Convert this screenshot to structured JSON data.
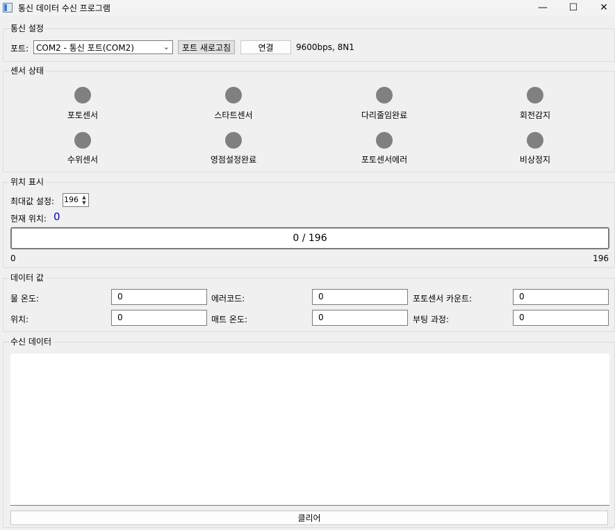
{
  "window": {
    "title": "통신 데이터 수신 프로그램",
    "minimize_glyph": "—",
    "maximize_glyph": "☐",
    "close_glyph": "✕",
    "icon": "app-window-icon"
  },
  "comm": {
    "title": "통신 설정",
    "port_label": "포트:",
    "port_value": "COM2 - 통신 포트(COM2)",
    "refresh_label": "포트 새로고침",
    "connect_label": "연결",
    "settings_text": "9600bps, 8N1"
  },
  "sensors": {
    "title": "센서 상태",
    "items": [
      {
        "label": "포토센서",
        "color": "#808080"
      },
      {
        "label": "스타트센서",
        "color": "#808080"
      },
      {
        "label": "다리줄임완료",
        "color": "#808080"
      },
      {
        "label": "회전감지",
        "color": "#808080"
      },
      {
        "label": "수위센서",
        "color": "#808080"
      },
      {
        "label": "영점설정완료",
        "color": "#808080"
      },
      {
        "label": "포토센서에러",
        "color": "#808080"
      },
      {
        "label": "비상정지",
        "color": "#808080"
      }
    ]
  },
  "position": {
    "title": "위치 표시",
    "max_label": "최대값 설정:",
    "max_value": "196",
    "current_label": "현재 위치:",
    "current_value": "0",
    "current_color": "#0000c0",
    "progress_text": "0 / 196",
    "progress_fraction": 0,
    "min_tick": "0",
    "max_tick": "196"
  },
  "data_values": {
    "title": "데이터 값",
    "rows": [
      [
        {
          "label": "물 온도:",
          "value": "0"
        },
        {
          "label": "에러코드:",
          "value": "0"
        },
        {
          "label": "포토센서 카운트:",
          "value": "0"
        }
      ],
      [
        {
          "label": "위치:",
          "value": "0"
        },
        {
          "label": "매트 온도:",
          "value": "0"
        },
        {
          "label": "부팅 과정:",
          "value": "0"
        }
      ]
    ]
  },
  "received": {
    "title": "수신 데이터",
    "content": "",
    "clear_label": "클리어"
  }
}
